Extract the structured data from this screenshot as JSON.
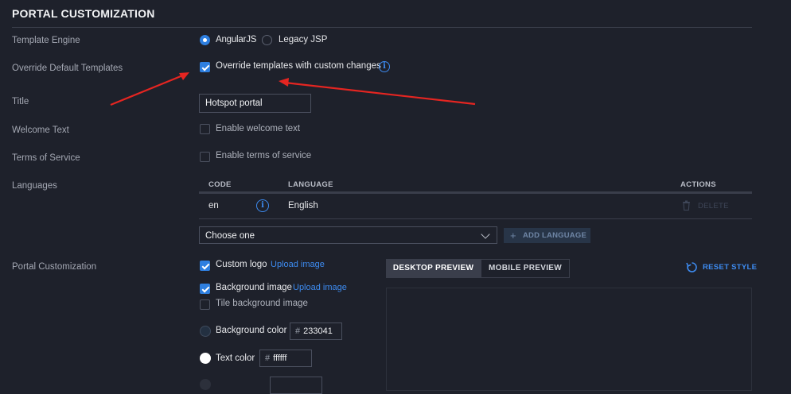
{
  "section": {
    "title": "PORTAL CUSTOMIZATION"
  },
  "labels": {
    "template_engine": "Template Engine",
    "override_default_templates": "Override Default Templates",
    "title": "Title",
    "welcome_text": "Welcome Text",
    "terms_of_service": "Terms of Service",
    "languages": "Languages",
    "portal_customization": "Portal Customization"
  },
  "template_engine": {
    "options": [
      {
        "label": "AngularJS",
        "selected": true
      },
      {
        "label": "Legacy JSP",
        "selected": false
      }
    ]
  },
  "override": {
    "label": "Override templates with custom changes",
    "checked": true
  },
  "title_field": {
    "value": "Hotspot portal"
  },
  "welcome": {
    "label": "Enable welcome text",
    "checked": false
  },
  "terms": {
    "label": "Enable terms of service",
    "checked": false
  },
  "languages_table": {
    "headers": {
      "code": "CODE",
      "language": "LANGUAGE",
      "actions": "ACTIONS"
    },
    "rows": [
      {
        "code": "en",
        "language": "English",
        "action": "DELETE"
      }
    ]
  },
  "language_select": {
    "value": "Choose one"
  },
  "add_language": {
    "label": "ADD LANGUAGE"
  },
  "customization": {
    "custom_logo": {
      "label": "Custom logo",
      "checked": true,
      "link": "Upload image"
    },
    "background_image": {
      "label": "Background image",
      "checked": true,
      "link": "Upload image"
    },
    "tile_background": {
      "label": "Tile background image",
      "checked": false
    },
    "background_color": {
      "label": "Background color",
      "value": "233041",
      "swatch": "#233041"
    },
    "text_color": {
      "label": "Text color",
      "value": "ffffff",
      "swatch": "#ffffff"
    }
  },
  "preview": {
    "tabs": [
      {
        "label": "DESKTOP PREVIEW",
        "active": true
      },
      {
        "label": "MOBILE PREVIEW",
        "active": false
      }
    ],
    "reset": "RESET STYLE"
  },
  "colors": {
    "accent": "#2e7fe0",
    "background": "#1e212b",
    "annotation_arrow": "#e52521"
  }
}
